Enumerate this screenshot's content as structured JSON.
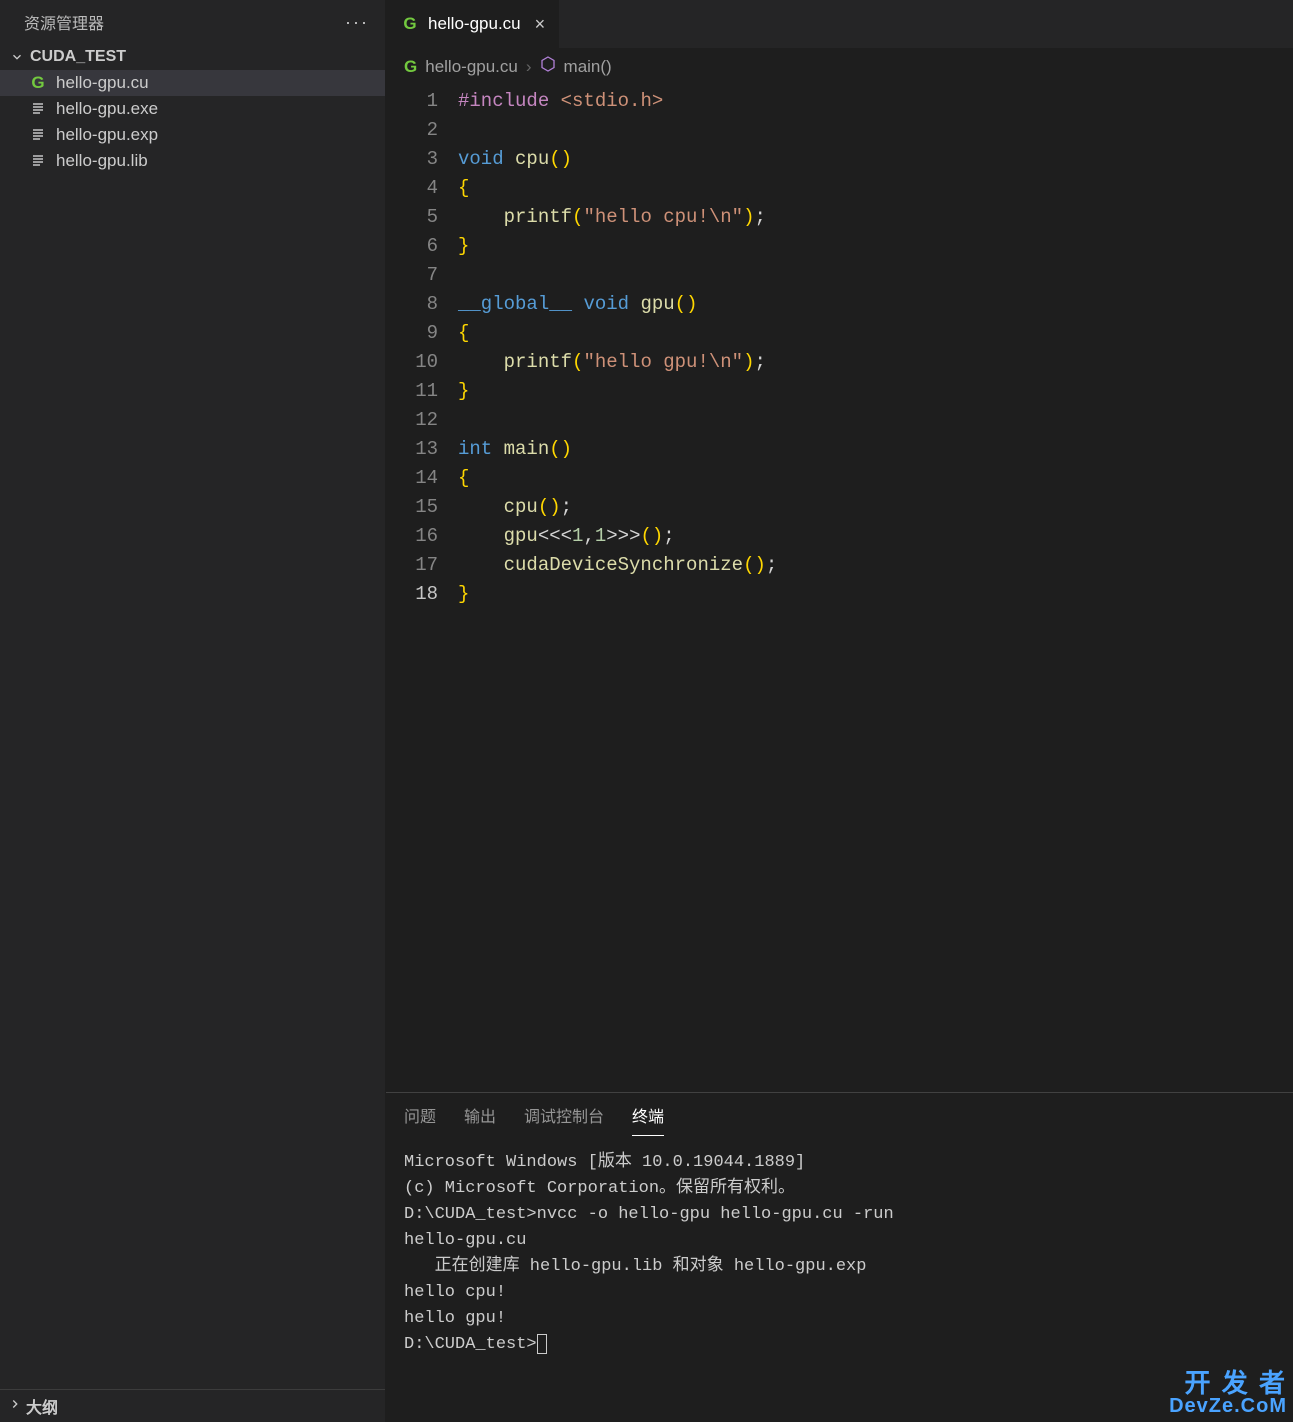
{
  "explorer": {
    "title": "资源管理器",
    "ellipsis": "···",
    "folder": "CUDA_TEST",
    "files": [
      {
        "name": "hello-gpu.cu",
        "icon": "cu",
        "active": true
      },
      {
        "name": "hello-gpu.exe",
        "icon": "gen",
        "active": false
      },
      {
        "name": "hello-gpu.exp",
        "icon": "gen",
        "active": false
      },
      {
        "name": "hello-gpu.lib",
        "icon": "gen",
        "active": false
      }
    ],
    "outline": "大纲"
  },
  "tabs": [
    {
      "label": "hello-gpu.cu",
      "icon": "cu"
    }
  ],
  "breadcrumb": {
    "file": "hello-gpu.cu",
    "symbol": "main()"
  },
  "code": {
    "current_line": 18,
    "tokens": [
      [
        {
          "c": "tok-mac",
          "t": "#include"
        },
        {
          "c": "",
          "t": " "
        },
        {
          "c": "tok-inc",
          "t": "<stdio.h>"
        }
      ],
      [],
      [
        {
          "c": "tok-type",
          "t": "void"
        },
        {
          "c": "",
          "t": " "
        },
        {
          "c": "tok-fn",
          "t": "cpu"
        },
        {
          "c": "tok-brace",
          "t": "()"
        }
      ],
      [
        {
          "c": "tok-brace",
          "t": "{"
        }
      ],
      [
        {
          "c": "",
          "t": "    "
        },
        {
          "c": "tok-fn",
          "t": "printf"
        },
        {
          "c": "tok-brace",
          "t": "("
        },
        {
          "c": "tok-str",
          "t": "\"hello cpu!\\n\""
        },
        {
          "c": "tok-brace",
          "t": ")"
        },
        {
          "c": "tok-pun",
          "t": ";"
        }
      ],
      [
        {
          "c": "tok-brace",
          "t": "}"
        }
      ],
      [],
      [
        {
          "c": "tok-mod",
          "t": "__global__"
        },
        {
          "c": "",
          "t": " "
        },
        {
          "c": "tok-type",
          "t": "void"
        },
        {
          "c": "",
          "t": " "
        },
        {
          "c": "tok-fn",
          "t": "gpu"
        },
        {
          "c": "tok-brace",
          "t": "()"
        }
      ],
      [
        {
          "c": "tok-brace",
          "t": "{"
        }
      ],
      [
        {
          "c": "",
          "t": "    "
        },
        {
          "c": "tok-fn",
          "t": "printf"
        },
        {
          "c": "tok-brace",
          "t": "("
        },
        {
          "c": "tok-str",
          "t": "\"hello gpu!\\n\""
        },
        {
          "c": "tok-brace",
          "t": ")"
        },
        {
          "c": "tok-pun",
          "t": ";"
        }
      ],
      [
        {
          "c": "tok-brace",
          "t": "}"
        }
      ],
      [],
      [
        {
          "c": "tok-type",
          "t": "int"
        },
        {
          "c": "",
          "t": " "
        },
        {
          "c": "tok-fn",
          "t": "main"
        },
        {
          "c": "tok-brace",
          "t": "()"
        }
      ],
      [
        {
          "c": "tok-brace",
          "t": "{"
        }
      ],
      [
        {
          "c": "",
          "t": "    "
        },
        {
          "c": "tok-fn",
          "t": "cpu"
        },
        {
          "c": "tok-brace",
          "t": "()"
        },
        {
          "c": "tok-pun",
          "t": ";"
        }
      ],
      [
        {
          "c": "",
          "t": "    "
        },
        {
          "c": "tok-fn",
          "t": "gpu"
        },
        {
          "c": "tok-pun",
          "t": "<<<"
        },
        {
          "c": "tok-num",
          "t": "1"
        },
        {
          "c": "tok-pun",
          "t": ","
        },
        {
          "c": "tok-num",
          "t": "1"
        },
        {
          "c": "tok-pun",
          "t": ">>>"
        },
        {
          "c": "tok-brace",
          "t": "()"
        },
        {
          "c": "tok-pun",
          "t": ";"
        }
      ],
      [
        {
          "c": "",
          "t": "    "
        },
        {
          "c": "tok-fn",
          "t": "cudaDeviceSynchronize"
        },
        {
          "c": "tok-brace",
          "t": "()"
        },
        {
          "c": "tok-pun",
          "t": ";"
        }
      ],
      [
        {
          "c": "tok-brace",
          "t": "}"
        }
      ]
    ]
  },
  "panel": {
    "tabs": [
      {
        "label": "问题",
        "active": false
      },
      {
        "label": "输出",
        "active": false
      },
      {
        "label": "调试控制台",
        "active": false
      },
      {
        "label": "终端",
        "active": true
      }
    ],
    "terminal_lines": [
      "Microsoft Windows [版本 10.0.19044.1889]",
      "(c) Microsoft Corporation。保留所有权利。",
      "",
      "D:\\CUDA_test>nvcc -o hello-gpu hello-gpu.cu -run",
      "hello-gpu.cu",
      "   正在创建库 hello-gpu.lib 和对象 hello-gpu.exp",
      "hello cpu!",
      "hello gpu!",
      "",
      "D:\\CUDA_test>"
    ]
  },
  "watermark": {
    "l1": "开 发 者",
    "l2": "DevZe.CoM"
  }
}
